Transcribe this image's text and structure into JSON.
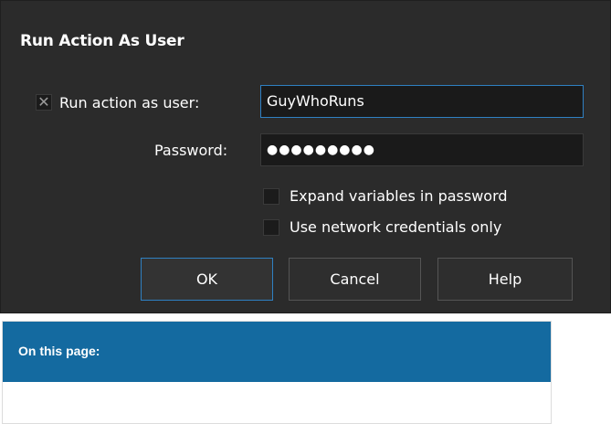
{
  "dialog": {
    "title": "Run Action As User",
    "run_as_user": {
      "checked_glyph": "✕",
      "label": "Run action as user:",
      "value": "GuyWhoRuns"
    },
    "password": {
      "label": "Password:",
      "value": "●●●●●●●●●"
    },
    "expand_variables": {
      "label": "Expand variables in password",
      "checked": false
    },
    "network_credentials": {
      "label": "Use network credentials only",
      "checked": false
    },
    "buttons": {
      "ok": "OK",
      "cancel": "Cancel",
      "help": "Help"
    }
  },
  "toc": {
    "title": "On this page:"
  },
  "colors": {
    "dialog_bg": "#2b2b2b",
    "input_bg": "#1a1a1a",
    "focus_accent": "#2f80c2",
    "toc_header": "#146aa0"
  }
}
